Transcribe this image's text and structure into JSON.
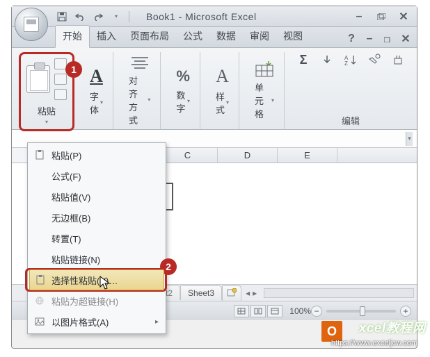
{
  "titlebar": {
    "title": "Book1 - Microsoft Excel"
  },
  "tabs": {
    "home": "开始",
    "insert": "插入",
    "layout": "页面布局",
    "formula": "公式",
    "data": "数据",
    "review": "审阅",
    "view": "视图"
  },
  "ribbon": {
    "paste": "粘贴",
    "font": "字体",
    "align": "对齐方式",
    "number": "数字",
    "style": "样式",
    "cells": "单元格",
    "editing": "编辑"
  },
  "callouts": {
    "one": "1",
    "two": "2"
  },
  "menu": {
    "paste": "粘贴(P)",
    "formula": "公式(F)",
    "values": "粘贴值(V)",
    "noborder": "无边框(B)",
    "transpose": "转置(T)",
    "pastelink": "粘贴链接(N)",
    "special": "选择性粘贴(V)…",
    "hyperlink": "粘贴为超链接(H)",
    "aspicture": "以图片格式(A)"
  },
  "columns": {
    "c": "C",
    "d": "D",
    "e": "E"
  },
  "sheets": {
    "s2_tail": "t2",
    "s3": "Sheet3"
  },
  "status": {
    "zoom": "100%"
  },
  "watermark": {
    "brand": "xcel教程网",
    "url": "https://www.exceljcw.com",
    "logo": "O"
  }
}
